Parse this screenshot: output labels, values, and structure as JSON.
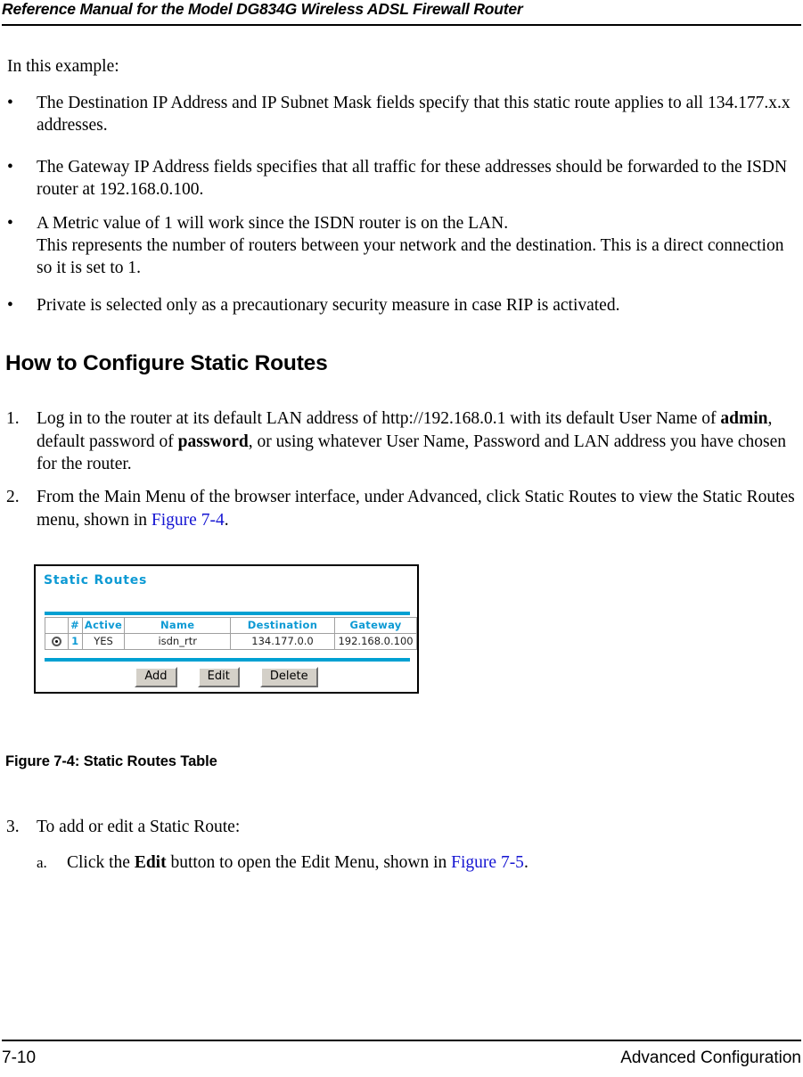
{
  "page": {
    "header_title": "Reference Manual for the Model DG834G Wireless ADSL Firewall Router",
    "footer_page_number": "7-10",
    "footer_section": "Advanced Configuration"
  },
  "body": {
    "intro": "In this example:",
    "bullets": [
      {
        "marker": "•",
        "text": "The Destination IP Address and IP Subnet Mask fields specify that this static route applies to all 134.177.x.x addresses."
      },
      {
        "marker": "•",
        "text": "The Gateway IP Address fields specifies that all traffic for these addresses should be forwarded to the ISDN router at 192.168.0.100."
      },
      {
        "marker": "•",
        "line1": "A Metric value of 1 will work since the ISDN router is on the LAN.",
        "line2": "This represents the number of routers between your network and the destination. This is a direct connection so it is set to 1."
      },
      {
        "marker": "•",
        "text": "Private is selected only as a precautionary security measure in case RIP is activated."
      }
    ],
    "section_heading": "How to Configure Static Routes",
    "steps": [
      {
        "marker": "1.",
        "part1": "Log in to the router at its default LAN address of http://192.168.0.1 with its default User Name of ",
        "bold1": "admin",
        "part2": ", default password of ",
        "bold2": "password",
        "part3": ", or using whatever User Name, Password and LAN address you have chosen for the router."
      },
      {
        "marker": "2.",
        "part1": "From the Main Menu of the browser interface, under Advanced, click Static Routes to view the Static Routes menu, shown in ",
        "xref": "Figure 7-4",
        "part2": "."
      },
      {
        "marker": "3.",
        "text": "To add or edit a Static Route:"
      }
    ],
    "substeps": [
      {
        "marker": "a.",
        "part1": "Click the ",
        "bold1": "Edit",
        "part2": " button to open the Edit Menu, shown in ",
        "xref": "Figure 7-5",
        "part3": "."
      }
    ],
    "figure_caption": "Figure 7-4:  Static Routes Table"
  },
  "figure": {
    "title": "Static Routes",
    "accent_color": "#00a0d2",
    "heading_color": "#0d9ad4",
    "table": {
      "headers": [
        "",
        "#",
        "Active",
        "Name",
        "Destination",
        "Gateway"
      ],
      "rows": [
        {
          "selected": true,
          "number": "1",
          "active": "YES",
          "name": "isdn_rtr",
          "destination": "134.177.0.0",
          "gateway": "192.168.0.100"
        }
      ]
    },
    "buttons": [
      {
        "label": "Add"
      },
      {
        "label": "Edit"
      },
      {
        "label": "Delete"
      }
    ]
  }
}
